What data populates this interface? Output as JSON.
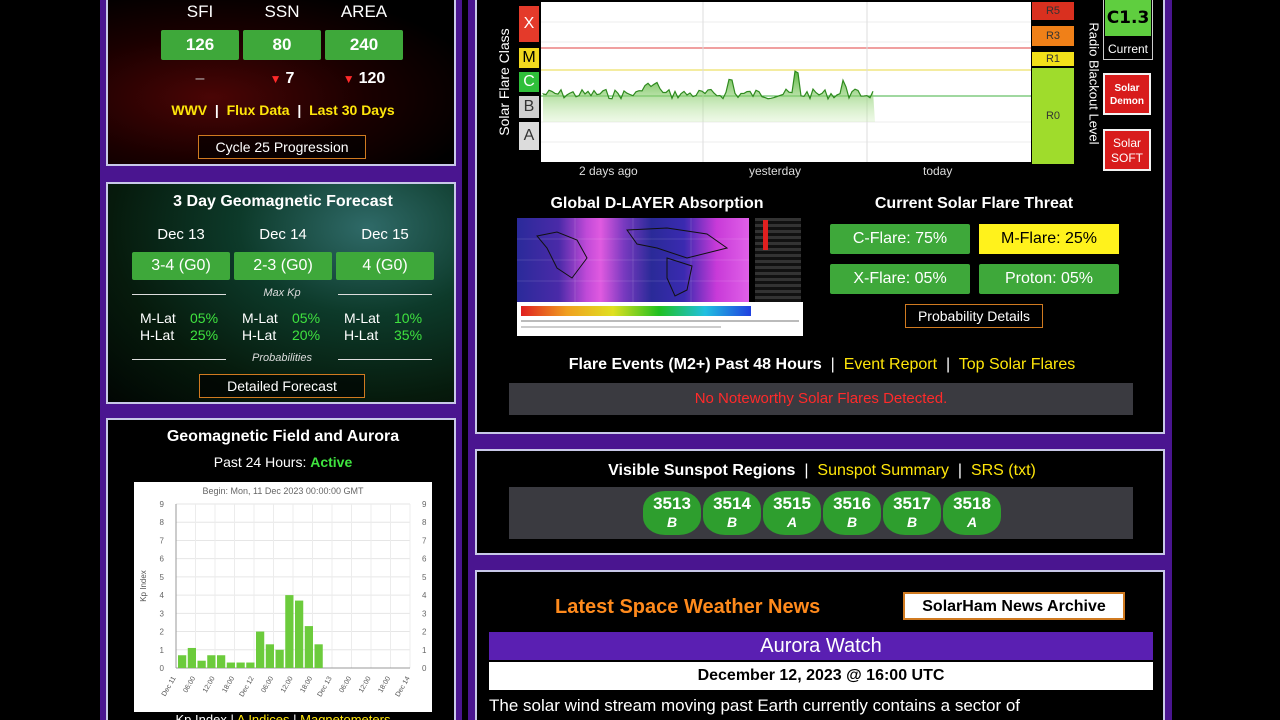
{
  "solar_indices": {
    "headers": [
      "SFI",
      "SSN",
      "AREA"
    ],
    "values": [
      "126",
      "80",
      "240"
    ],
    "changes": [
      "–",
      "7",
      "120"
    ],
    "change_arrow": "▼",
    "links": [
      "WWV",
      "Flux Data",
      "Last 30 Days"
    ],
    "cycle_button": "Cycle 25 Progression"
  },
  "geomag_forecast": {
    "title": "3 Day Geomagnetic Forecast",
    "days": [
      {
        "date": "Dec 13",
        "kp": "3-4 (G0)",
        "mlat_label": "M-Lat",
        "mlat": "05%",
        "hlat_label": "H-Lat",
        "hlat": "25%"
      },
      {
        "date": "Dec 14",
        "kp": "2-3 (G0)",
        "mlat_label": "M-Lat",
        "mlat": "05%",
        "hlat_label": "H-Lat",
        "hlat": "20%"
      },
      {
        "date": "Dec 15",
        "kp": "4 (G0)",
        "mlat_label": "M-Lat",
        "mlat": "10%",
        "hlat_label": "H-Lat",
        "hlat": "35%"
      }
    ],
    "max_kp_label": "Max Kp",
    "probabilities_label": "Probabilities",
    "detailed_button": "Detailed Forecast"
  },
  "geomag_field": {
    "title": "Geomagnetic Field and Aurora",
    "past_label": "Past 24 Hours:",
    "status": "Active",
    "chart_begin": "Begin: Mon, 11 Dec 2023 00:00:00 GMT",
    "chart_ylabel": "Kp Index",
    "y_ticks": [
      "9",
      "8",
      "7",
      "6",
      "5",
      "4",
      "3",
      "2",
      "1",
      "0"
    ],
    "x_ticks": [
      "Dec 11",
      "06:00",
      "12:00",
      "18:00",
      "Dec 12",
      "06:00",
      "12:00",
      "18:00",
      "Dec 13",
      "06:00",
      "12:00",
      "18:00",
      "Dec 14"
    ],
    "bottom_links": [
      "Kp Index",
      "A Indices",
      "Magnetometers"
    ]
  },
  "chart_data": {
    "type": "bar",
    "ylabel": "Kp Index",
    "ylim": [
      0,
      9
    ],
    "values": [
      0.7,
      1.1,
      0.4,
      0.7,
      0.7,
      0.3,
      0.3,
      0.3,
      2.0,
      1.3,
      1.0,
      4.0,
      3.7,
      2.3,
      1.3
    ]
  },
  "flare_chart": {
    "ylabel": "Solar Flare Class",
    "classes": [
      "X",
      "M",
      "C",
      "B",
      "A"
    ],
    "class_colors": [
      "#e43a2a",
      "#f2d81e",
      "#2fbf3a",
      "#cfcfcf",
      "#dcdcdc"
    ],
    "x_labels": [
      "2 days ago",
      "yesterday",
      "today"
    ],
    "radio_levels": [
      "R5",
      "R3",
      "R1",
      "R0"
    ],
    "radio_colors": [
      "#d9301f",
      "#f08018",
      "#f2e01a",
      "#9fdc2c"
    ],
    "radio_label": "Radio Blackout Level",
    "current_class": "C1.3",
    "current_label": "Current",
    "solar_demon": "Solar Demon",
    "solar_soft": "Solar SOFT"
  },
  "dlayer": {
    "title": "Global D-LAYER Absorption"
  },
  "flare_threat": {
    "title": "Current Solar Flare Threat",
    "items": [
      "C-Flare: 75%",
      "M-Flare: 25%",
      "X-Flare: 05%",
      "Proton: 05%"
    ],
    "details_button": "Probability Details"
  },
  "flare_events": {
    "label": "Flare Events (M2+) Past 48 Hours",
    "links": [
      "Event Report",
      "Top Solar Flares"
    ],
    "message": "No Noteworthy Solar Flares Detected."
  },
  "sunspots": {
    "label": "Visible Sunspot Regions",
    "links": [
      "Sunspot Summary",
      "SRS (txt)"
    ],
    "regions": [
      {
        "num": "3513",
        "cls": "B"
      },
      {
        "num": "3514",
        "cls": "B"
      },
      {
        "num": "3515",
        "cls": "A"
      },
      {
        "num": "3516",
        "cls": "B"
      },
      {
        "num": "3517",
        "cls": "B"
      },
      {
        "num": "3518",
        "cls": "A"
      }
    ]
  },
  "news": {
    "title": "Latest Space Weather News",
    "archive_button": "SolarHam News Archive",
    "headline": "Aurora Watch",
    "date": "December 12, 2023 @ 16:00 UTC",
    "body": "The solar wind stream moving past Earth currently contains a sector of"
  }
}
